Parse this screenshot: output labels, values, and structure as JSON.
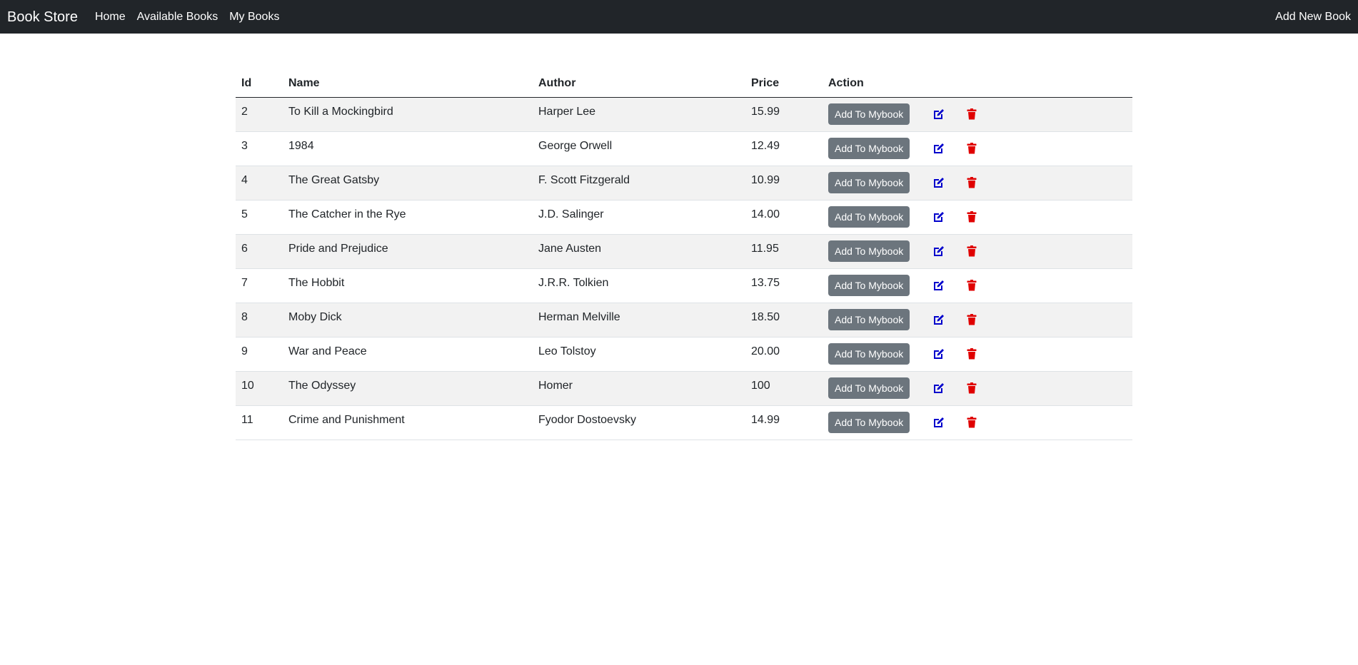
{
  "navbar": {
    "brand": "Book Store",
    "links": [
      "Home",
      "Available Books",
      "My Books"
    ],
    "right_link": "Add New Book"
  },
  "table": {
    "headers": [
      "Id",
      "Name",
      "Author",
      "Price",
      "Action"
    ],
    "action_label": "Add To Mybook",
    "rows": [
      {
        "id": "2",
        "name": "To Kill a Mockingbird",
        "author": "Harper Lee",
        "price": "15.99"
      },
      {
        "id": "3",
        "name": "1984",
        "author": "George Orwell",
        "price": "12.49"
      },
      {
        "id": "4",
        "name": "The Great Gatsby",
        "author": "F. Scott Fitzgerald",
        "price": "10.99"
      },
      {
        "id": "5",
        "name": "The Catcher in the Rye",
        "author": "J.D. Salinger",
        "price": "14.00"
      },
      {
        "id": "6",
        "name": "Pride and Prejudice",
        "author": "Jane Austen",
        "price": "11.95"
      },
      {
        "id": "7",
        "name": "The Hobbit",
        "author": "J.R.R. Tolkien",
        "price": "13.75"
      },
      {
        "id": "8",
        "name": "Moby Dick",
        "author": "Herman Melville",
        "price": "18.50"
      },
      {
        "id": "9",
        "name": "War and Peace",
        "author": "Leo Tolstoy",
        "price": "20.00"
      },
      {
        "id": "10",
        "name": "The Odyssey",
        "author": "Homer",
        "price": "100"
      },
      {
        "id": "11",
        "name": "Crime and Punishment",
        "author": "Fyodor Dostoevsky",
        "price": "14.99"
      }
    ]
  },
  "icons": {
    "edit": "edit-icon",
    "delete": "trash-icon"
  },
  "colors": {
    "navbar_bg": "#212529",
    "button_bg": "#6c757d",
    "edit_icon": "#0000cc",
    "delete_icon": "#e00000",
    "striped_row": "#f2f2f2"
  }
}
